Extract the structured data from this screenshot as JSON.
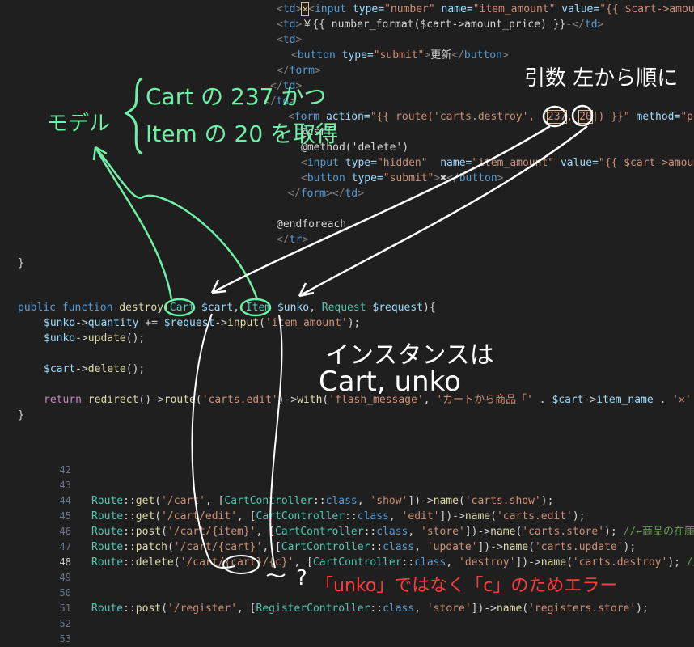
{
  "blade": {
    "l1_tdx": "✕",
    "l1_attr1": "type=",
    "l1_val1": "\"number\"",
    "l1_attr2": "name=",
    "l1_val2": "\"item_amount\"",
    "l1_attr3": "value=",
    "l1_val3": "\"{{ $cart->amoun",
    "l2_text": "￥{{ number_format($cart->amount_price) }}",
    "l4_attr": "type=",
    "l4_val": "\"submit\"",
    "l4_text": "更新",
    "l8_form": "<form",
    "l8_attr": "action=",
    "l8_val1": "\"{{ route('carts.destroy', [",
    "l8_val2": "237",
    "l8_val3": ", ",
    "l8_val4": "20",
    "l8_val5": "]) }}\"",
    "l8_attr2": "method=",
    "l8_val6": "\"po",
    "l9": "@csrf",
    "l10": "@method('delete')",
    "l11_val1": "\"hidden\"",
    "l11_val2": "\"item_amount\"",
    "l11_val3": "\"{{ $cart->amoun",
    "l12_val": "\"submit\"",
    "l12_text": "✖",
    "l14": "@endforeach"
  },
  "php": {
    "brace_close": "}",
    "sig_public": "public",
    "sig_function": "function",
    "sig_name": "destroy",
    "sig_class1": "Cart",
    "sig_var1": "$cart",
    "sig_class2": "Item",
    "sig_var2": "$unko",
    "sig_class3": "Request",
    "sig_var3": "$request",
    "b1_var": "$unko",
    "b1_prop": "quantity",
    "b1_var2": "$request",
    "b1_fn": "input",
    "b1_str": "'item_amount'",
    "b2_var": "$unko",
    "b2_fn": "update",
    "b3_var": "$cart",
    "b3_fn": "delete",
    "ret_kw": "return",
    "ret_fn1": "redirect",
    "ret_fn2": "route",
    "ret_str1": "'carts.edit'",
    "ret_fn3": "with",
    "ret_str2": "'flash_message'",
    "ret_str3": "'カートから商品「' ",
    "ret_var": "$cart",
    "ret_prop": "item_name",
    "ret_str4": "'✕'",
    "end_brace": "}"
  },
  "routes": {
    "line_numbers": [
      "42",
      "43",
      "44",
      "45",
      "46",
      "47",
      "48",
      "49",
      "50",
      "51",
      "52",
      "53"
    ],
    "active_line": "48",
    "r44": {
      "method": "get",
      "path": "'/cart'",
      "class": "CartController",
      "action": "'show'",
      "name": "'carts.show'"
    },
    "r45": {
      "method": "get",
      "path": "'/cart/edit'",
      "class": "CartController",
      "action": "'edit'",
      "name": "'carts.edit'"
    },
    "r46": {
      "method": "post",
      "path": "'/cart/{item}'",
      "class": "CartController",
      "action": "'store'",
      "name": "'carts.store'",
      "comment": "//←商品の在庫"
    },
    "r47": {
      "method": "patch",
      "path": "'/cart/{cart}'",
      "class": "CartController",
      "action": "'update'",
      "name": "'carts.update'"
    },
    "r48": {
      "method": "delete",
      "path": "'/cart/{cart}/{c}'",
      "class": "CartController",
      "action": "'destroy'",
      "name": "'carts.destroy'",
      "comment": "//←"
    },
    "r51": {
      "method": "post",
      "path": "'/register'",
      "class": "RegisterController",
      "action": "'store'",
      "name": "'registers.store'"
    }
  },
  "annotations": {
    "model_label": "モデル",
    "model_line1": "Cart の 237 かつ",
    "model_line2": "Item の 20 を取得",
    "args_label": "引数 左から順に",
    "instance_line1": "インスタンスは",
    "instance_line2": "Cart, unko",
    "error_qmark": "?",
    "error_text": "「unko」ではなく「c」のためエラー",
    "colors": {
      "green": "#6ef0a6",
      "white": "#ffffff",
      "red": "#ff3b3b"
    }
  }
}
